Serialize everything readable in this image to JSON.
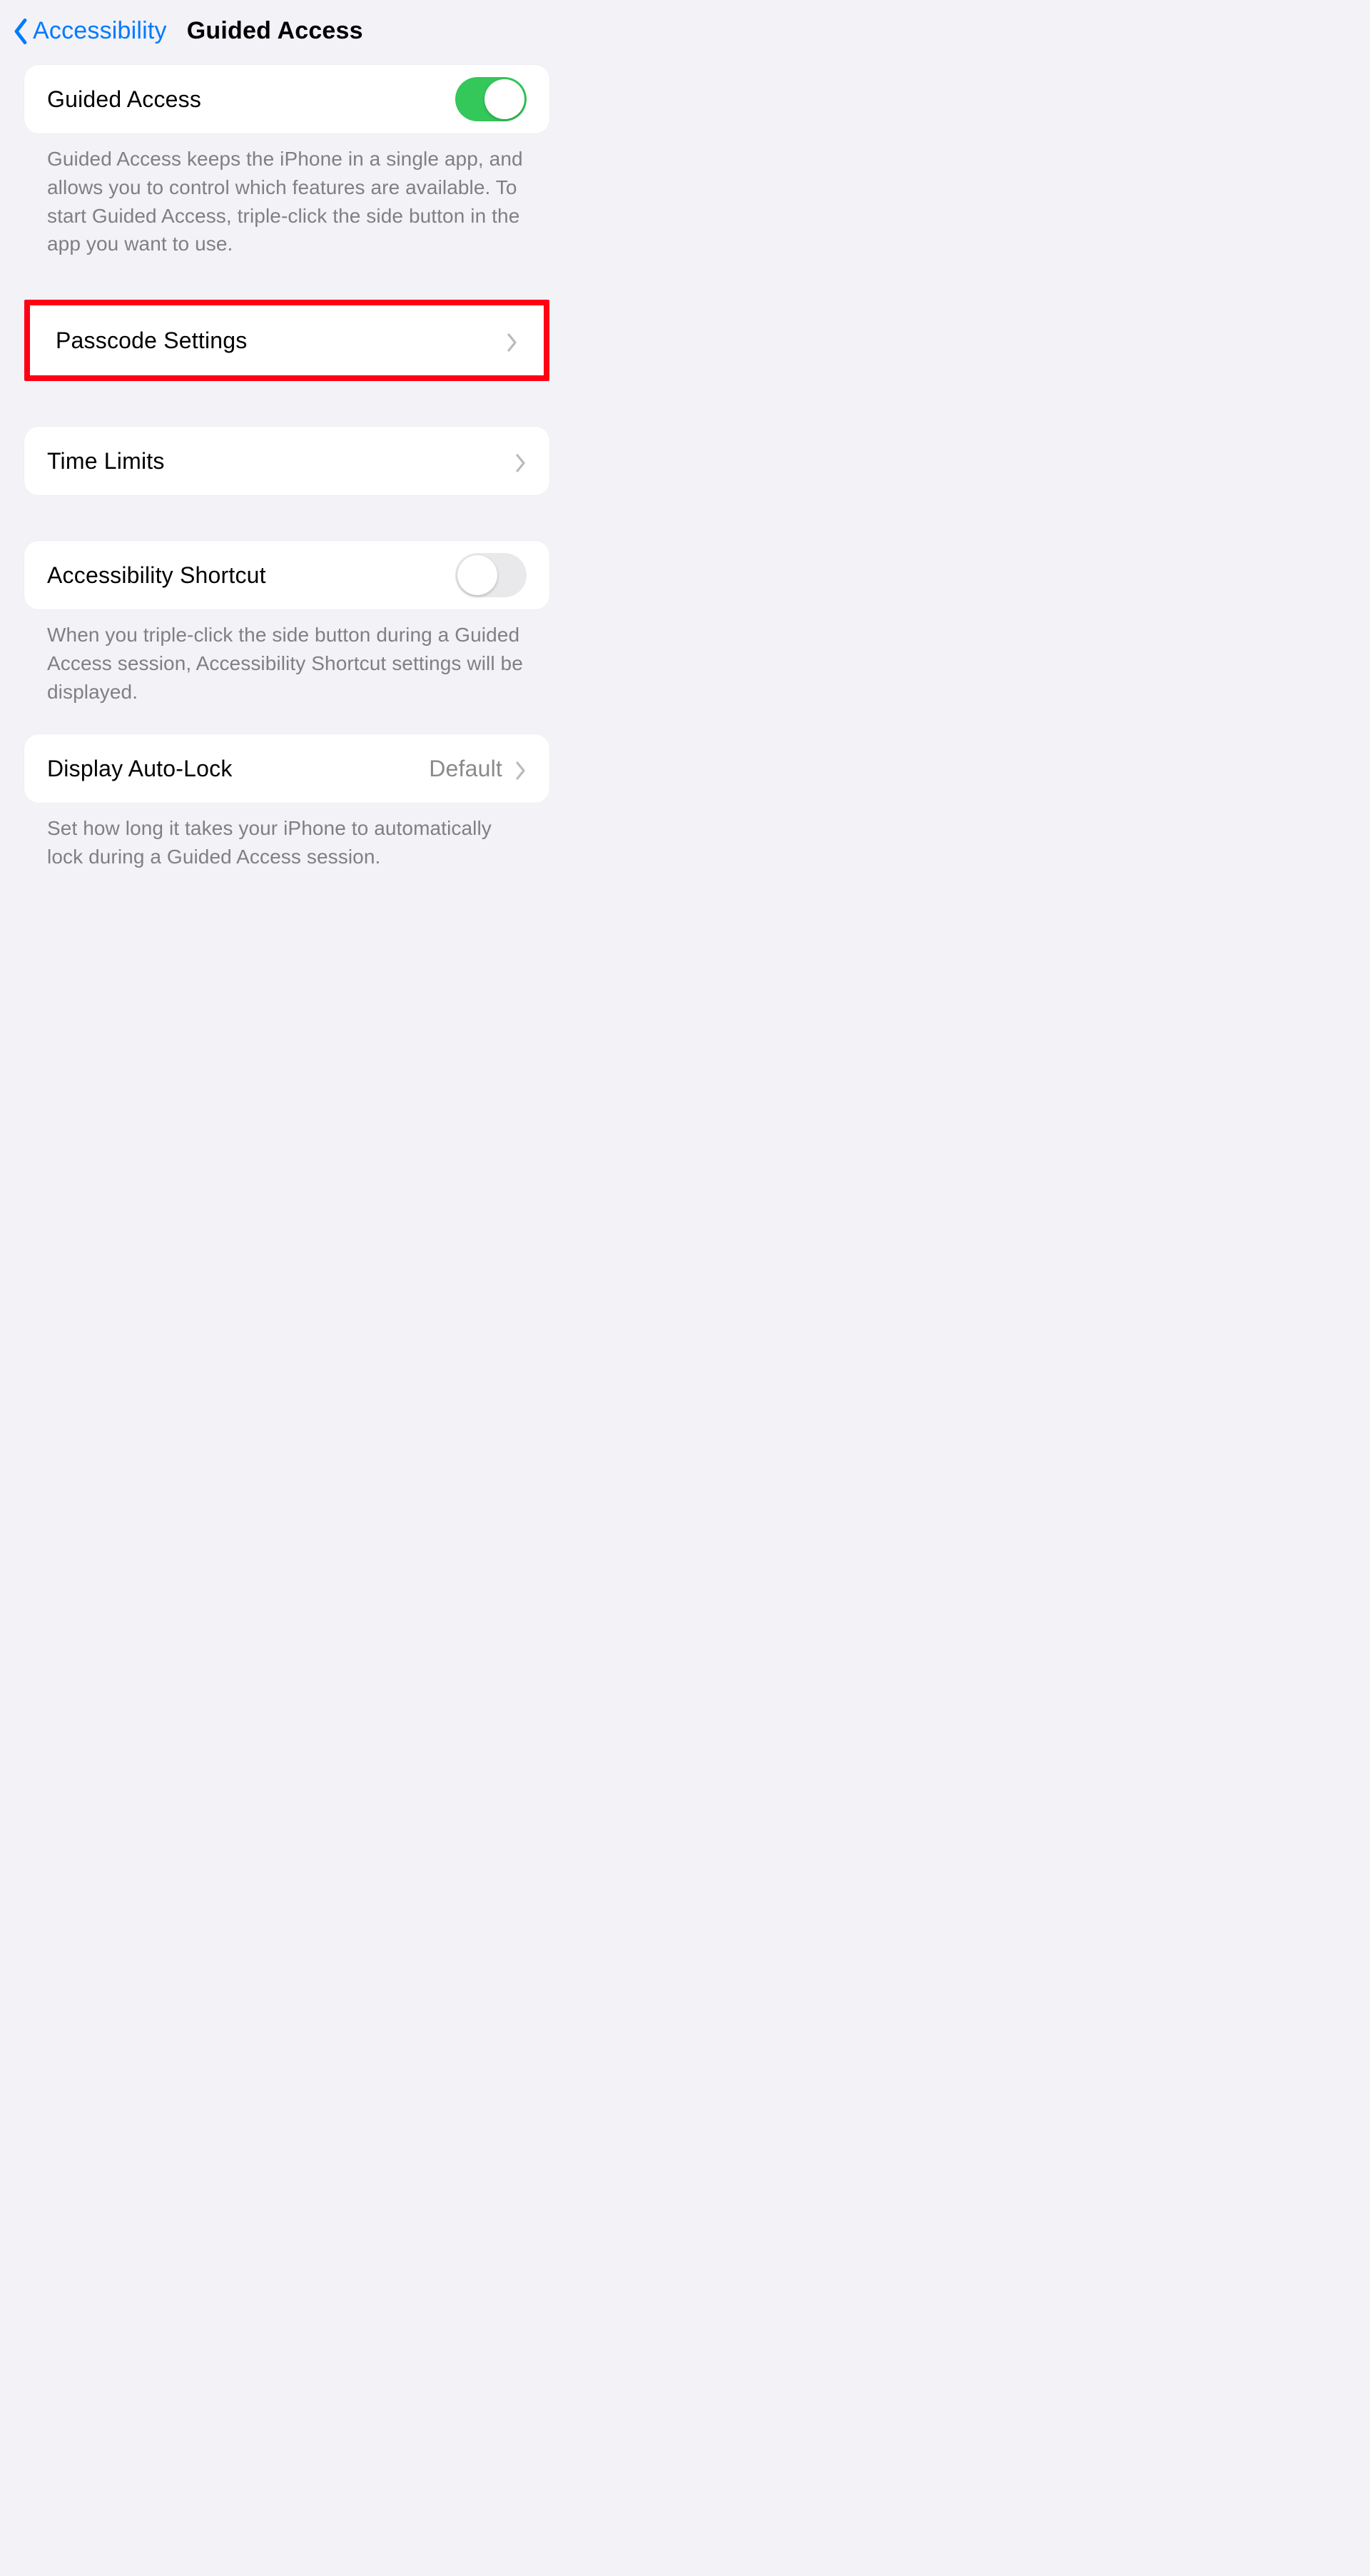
{
  "nav": {
    "back_label": "Accessibility",
    "title": "Guided Access"
  },
  "section1": {
    "row": {
      "label": "Guided Access",
      "toggle_on": true
    },
    "footer": "Guided Access keeps the iPhone in a single app, and allows you to control which features are available. To start Guided Access, triple-click the side button in the app you want to use."
  },
  "section2": {
    "row": {
      "label": "Passcode Settings"
    }
  },
  "section3": {
    "row": {
      "label": "Time Limits"
    }
  },
  "section4": {
    "row": {
      "label": "Accessibility Shortcut",
      "toggle_on": false
    },
    "footer": "When you triple-click the side button during a Guided Access session, Accessibility Shortcut settings will be displayed."
  },
  "section5": {
    "row": {
      "label": "Display Auto-Lock",
      "value": "Default"
    },
    "footer": "Set how long it takes your iPhone to automatically lock during a Guided Access session."
  },
  "highlight_color": "#ff0014"
}
